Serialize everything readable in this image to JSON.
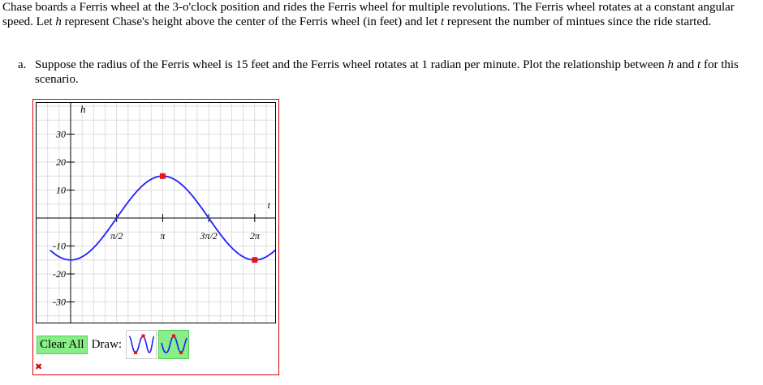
{
  "problem": {
    "text_1": "Chase boards a Ferris wheel at the 3-o'clock position and rides the Ferris wheel for multiple revolutions. The Ferris wheel rotates at a constant angular speed. Let ",
    "var_h": "h",
    "text_2": " represent Chase's height above the center of the Ferris wheel (in feet) and let ",
    "var_t": "t",
    "text_3": " represent the number of mintues since the ride started."
  },
  "part_a": {
    "label": "a.",
    "text_1": "Suppose the radius of the Ferris wheel is 15 feet and the Ferris wheel rotates at 1 radian per minute. Plot the relationship between ",
    "var_h": "h",
    "text_2": " and ",
    "var_t": "t",
    "text_3": " for this scenario."
  },
  "toolbar": {
    "clear_label": "Clear All",
    "draw_label": "Draw:",
    "tools": [
      {
        "name": "sine-tool",
        "selected": false
      },
      {
        "name": "cosine-tool",
        "selected": true
      }
    ]
  },
  "status": {
    "incorrect_mark": "✖"
  },
  "colors": {
    "curve": "#1f1fff",
    "point": "#ee1111",
    "border": "#dd0000",
    "button": "#88ee88",
    "grid": "#dddddd"
  },
  "chart_data": {
    "type": "line",
    "xlabel": "t",
    "ylabel": "h",
    "xlim": [
      -0.7,
      4.45
    ],
    "ylim": [
      -38,
      35
    ],
    "grid": true,
    "x_ticks": [
      {
        "value": 1.5708,
        "label": "π/2"
      },
      {
        "value": 3.1416,
        "label": "π"
      },
      {
        "value": 4.7124,
        "label": "3π/2"
      },
      {
        "value": 6.2832,
        "label": "2π"
      }
    ],
    "x_tick_scale": 0.5,
    "y_ticks": [
      {
        "value": 30,
        "label": "30"
      },
      {
        "value": 20,
        "label": "20"
      },
      {
        "value": 10,
        "label": "10"
      },
      {
        "value": -10,
        "label": "-10"
      },
      {
        "value": -20,
        "label": "-20"
      },
      {
        "value": -30,
        "label": "-30"
      }
    ],
    "series": [
      {
        "function": "-15*cos(t - pi/2 ... )",
        "amplitude": 15,
        "midline": 0,
        "period_units": "2π",
        "key_points": [
          [
            0,
            -15
          ],
          [
            3.1416,
            15
          ],
          [
            6.2832,
            -15
          ]
        ]
      }
    ]
  }
}
